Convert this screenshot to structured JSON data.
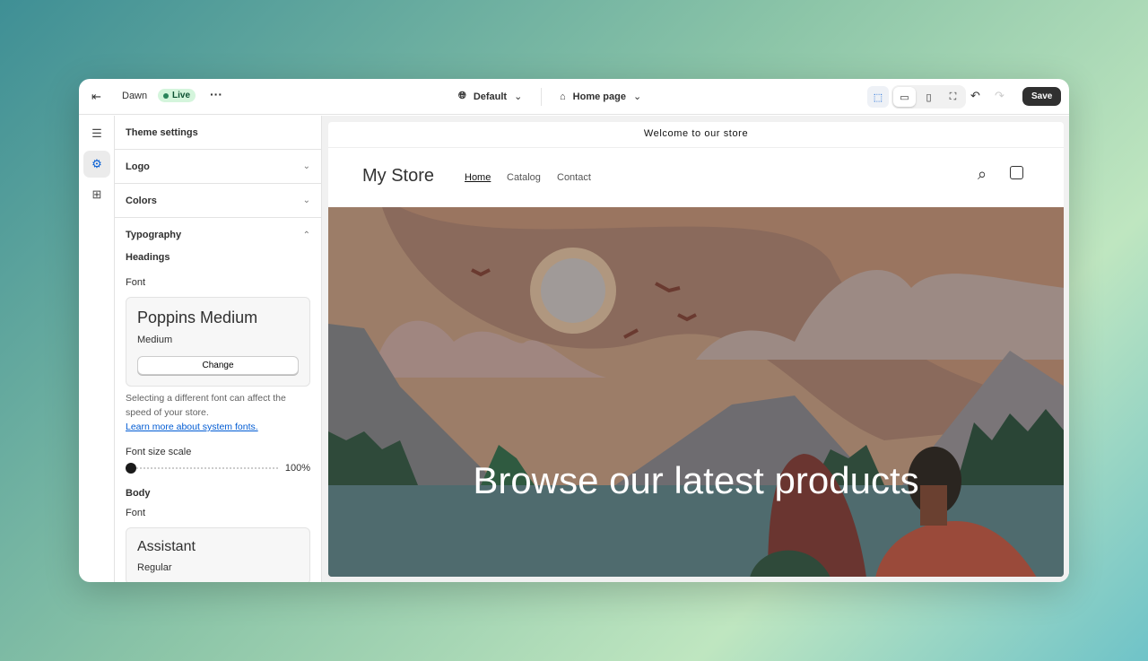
{
  "topbar": {
    "theme_name": "Dawn",
    "status": "Live",
    "view": "Default",
    "page": "Home page",
    "save_label": "Save"
  },
  "sidebar": {
    "title": "Theme settings",
    "sections": [
      {
        "label": "Logo"
      },
      {
        "label": "Colors"
      },
      {
        "label": "Typography"
      }
    ],
    "typography": {
      "headings_label": "Headings",
      "font_label": "Font",
      "heading_font": "Poppins Medium",
      "heading_weight": "Medium",
      "change_label": "Change",
      "help_text": "Selecting a different font can affect the speed of your store.",
      "help_link": "Learn more about system fonts.",
      "scale_label": "Font size scale",
      "scale_value": "100%",
      "scale_fraction": 0.0,
      "body_label": "Body",
      "body_font_label": "Font",
      "body_font": "Assistant",
      "body_weight": "Regular"
    }
  },
  "store": {
    "announcement": "Welcome to our store",
    "name": "My Store",
    "nav": [
      "Home",
      "Catalog",
      "Contact"
    ],
    "hero_heading": "Browse our latest products"
  },
  "colors": {
    "accent": "#303030",
    "live": "#29845a",
    "link": "#005bd3"
  }
}
